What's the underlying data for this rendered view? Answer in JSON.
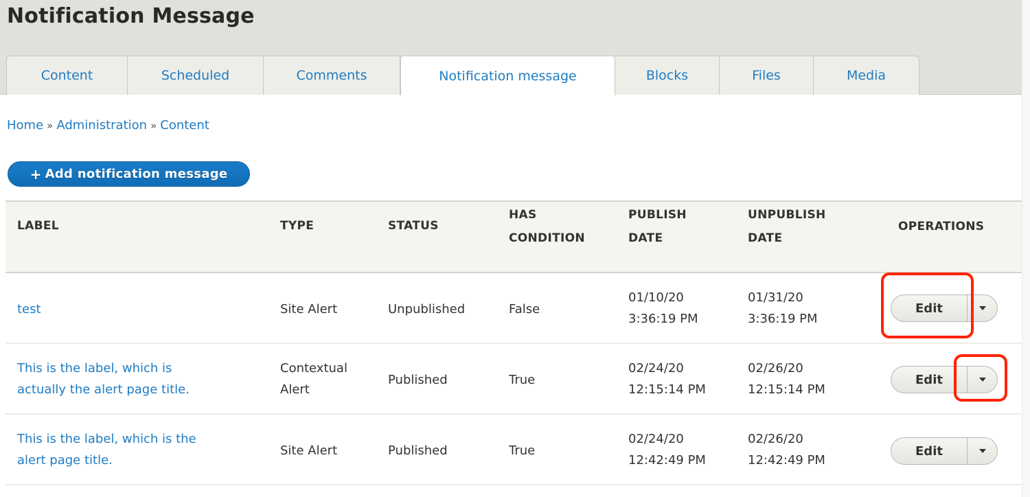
{
  "page": {
    "title": "Notification Message"
  },
  "tabs": [
    {
      "label": "Content",
      "active": false
    },
    {
      "label": "Scheduled",
      "active": false
    },
    {
      "label": "Comments",
      "active": false
    },
    {
      "label": "Notification message",
      "active": true
    },
    {
      "label": "Blocks",
      "active": false
    },
    {
      "label": "Files",
      "active": false
    },
    {
      "label": "Media",
      "active": false
    }
  ],
  "breadcrumb": {
    "items": [
      "Home",
      "Administration",
      "Content"
    ],
    "separator": "»"
  },
  "add_button": {
    "icon": "plus-icon",
    "plus": "+",
    "label": "Add notification message"
  },
  "table": {
    "headers": {
      "label": "LABEL",
      "type": "TYPE",
      "status": "STATUS",
      "has_condition_1": "HAS",
      "has_condition_2": "CONDITION",
      "publish_1": "PUBLISH",
      "publish_2": "DATE",
      "unpublish_1": "UNPUBLISH",
      "unpublish_2": "DATE",
      "operations": "OPERATIONS"
    },
    "rows": [
      {
        "label_1": "test",
        "label_2": "",
        "type_1": "Site Alert",
        "type_2": "",
        "status": "Unpublished",
        "has_condition": "False",
        "publish_date": "01/10/20",
        "publish_time": "3:36:19 PM",
        "unpublish_date": "01/31/20",
        "unpublish_time": "3:36:19 PM",
        "edit_label": "Edit"
      },
      {
        "label_1": "This is the label, which is",
        "label_2": "actually the alert page title.",
        "type_1": "Contextual",
        "type_2": "Alert",
        "status": "Published",
        "has_condition": "True",
        "publish_date": "02/24/20",
        "publish_time": "12:15:14 PM",
        "unpublish_date": "02/26/20",
        "unpublish_time": "12:15:14 PM",
        "edit_label": "Edit"
      },
      {
        "label_1": "This is the label, which is the",
        "label_2": "alert page title.",
        "type_1": "Site Alert",
        "type_2": "",
        "status": "Published",
        "has_condition": "True",
        "publish_date": "02/24/20",
        "publish_time": "12:42:49 PM",
        "unpublish_date": "02/26/20",
        "unpublish_time": "12:42:49 PM",
        "edit_label": "Edit"
      }
    ]
  },
  "annotations": {
    "highlight_color": "#ff2200",
    "targets": [
      "row-1-edit-button",
      "row-2-operations-toggle"
    ]
  },
  "colors": {
    "link": "#1f7cc2",
    "primary_button": "#1a7cc7",
    "header_bg": "#e1e0da"
  }
}
